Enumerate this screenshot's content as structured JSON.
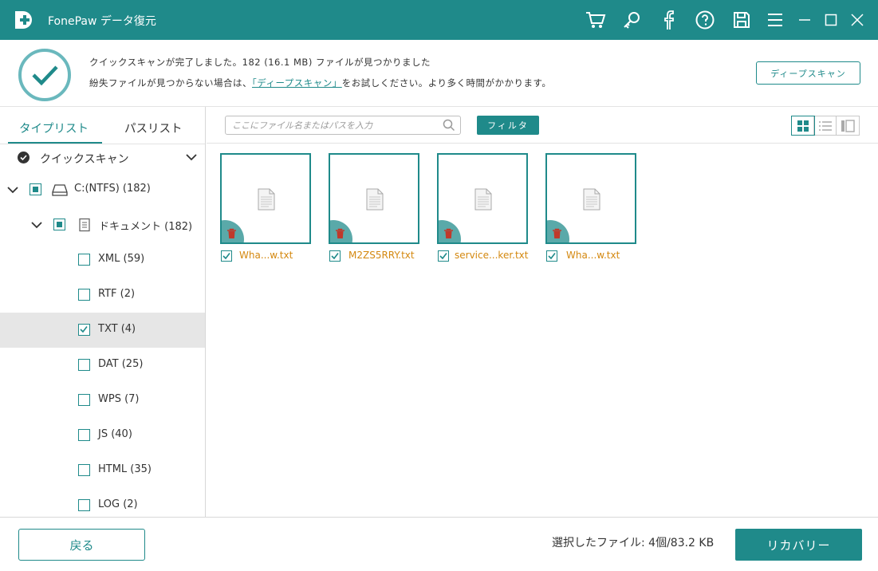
{
  "app": {
    "title": "FonePaw データ復元",
    "accent_color": "#1f8a8a"
  },
  "titlebar_icons": [
    "cart-icon",
    "key-icon",
    "facebook-icon",
    "help-icon",
    "save-icon",
    "menu-icon",
    "minimize-icon",
    "maximize-icon",
    "close-icon"
  ],
  "status": {
    "line1": "クイックスキャンが完了しました。182 (16.1 MB) ファイルが見つかりました",
    "line2_prefix": "紛失ファイルが見つからない場合は、",
    "line2_link": "「ディープスキャン」",
    "line2_suffix": "をお試しください。より多く時間がかかります。",
    "deep_scan_button": "ディープスキャン"
  },
  "sidebar": {
    "tabs": [
      {
        "label": "タイプリスト",
        "active": true
      },
      {
        "label": "パスリスト",
        "active": false
      }
    ],
    "quick_scan_label": "クイックスキャン",
    "tree": [
      {
        "label": "C:(NTFS) (182)",
        "state": "partial",
        "icon": "drive-icon"
      },
      {
        "label": "ドキュメント (182)",
        "state": "partial",
        "icon": "document-icon"
      },
      {
        "label": "XML (59)",
        "state": "unchecked"
      },
      {
        "label": "RTF (2)",
        "state": "unchecked"
      },
      {
        "label": "TXT (4)",
        "state": "checked",
        "selected": true
      },
      {
        "label": "DAT (25)",
        "state": "unchecked"
      },
      {
        "label": "WPS (7)",
        "state": "unchecked"
      },
      {
        "label": "JS (40)",
        "state": "unchecked"
      },
      {
        "label": "HTML (35)",
        "state": "unchecked"
      },
      {
        "label": "LOG (2)",
        "state": "unchecked"
      }
    ]
  },
  "toolbar": {
    "search_placeholder": "ここにファイル名またはパスを入力",
    "filter_label": "フィルタ",
    "view_modes": [
      "grid-view-icon",
      "list-view-icon",
      "detail-view-icon"
    ],
    "active_view": "grid"
  },
  "files": [
    {
      "name": "Wha...w.txt",
      "checked": true
    },
    {
      "name": "M2ZS5RRY.txt",
      "checked": true
    },
    {
      "name": "service...ker.txt",
      "checked": true
    },
    {
      "name": "Wha...w.txt",
      "checked": true
    }
  ],
  "footer": {
    "back_label": "戻る",
    "selected_info": "選択したファイル: 4個/83.2 KB",
    "recover_label": "リカバリー"
  }
}
